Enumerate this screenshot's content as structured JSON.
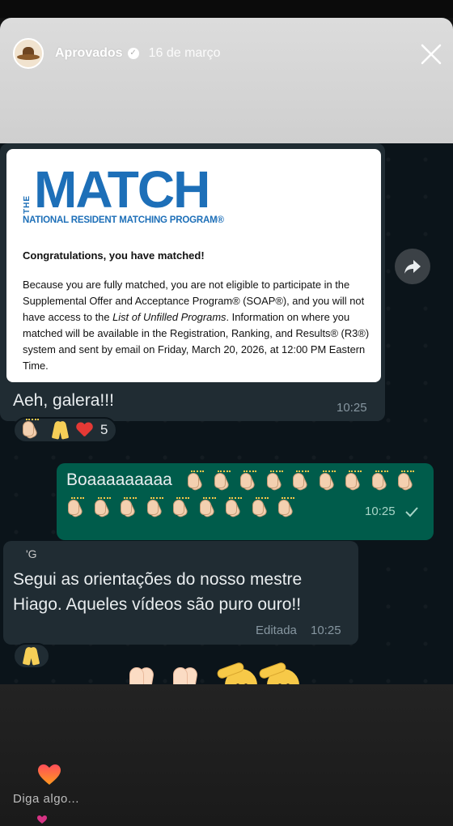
{
  "story": {
    "username": "Aprovados",
    "date": "16 de março"
  },
  "email": {
    "logo_the": "THE",
    "logo_match": "MATCH",
    "logo_subtitle": "NATIONAL RESIDENT MATCHING PROGRAM®",
    "heading": "Congratulations, you have matched!",
    "body_part1": "Because you are fully matched, you are not eligible to participate in the Supplemental Offer and Acceptance Program® (SOAP®), and you will not have access to the ",
    "body_italic": "List of Unfilled Programs",
    "body_part2": ". Information on where you matched will be available in the Registration, Ranking, and Results® (R3®) system and sent by email on Friday, March 20, 2026, at 12:00 PM Eastern Time."
  },
  "messages": [
    {
      "text": "Aeh, galera!!!",
      "time": "10:25",
      "reactions_count": "5"
    },
    {
      "text": "Boaaaaaaaaa",
      "time": "10:25",
      "status": "read"
    },
    {
      "sender": "'G",
      "text_line1": "Segui as orientações do nosso mestre",
      "text_line2": "Hiago. Aqueles vídeos são puro ouro!!",
      "edited_label": "Editada",
      "time": "10:25"
    }
  ],
  "reply": {
    "placeholder": "Diga algo..."
  },
  "colors": {
    "incoming_bubble": "#202c33",
    "outgoing_bubble": "#005c4b",
    "match_blue": "#1d6fb8",
    "chat_background": "#0b141a"
  },
  "icons": [
    "verified-icon",
    "close-icon",
    "forward-icon",
    "heart-icon",
    "pray-icon",
    "clap-icon",
    "salute-icon",
    "read-check-icon"
  ]
}
